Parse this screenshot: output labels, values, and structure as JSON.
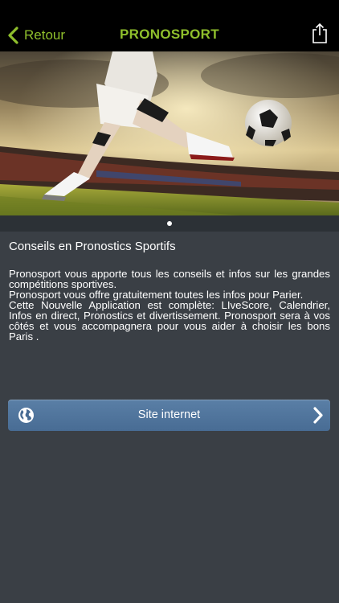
{
  "navbar": {
    "back_label": "Retour",
    "title": "PRONOSPORT",
    "accent_color": "#8fbf2c"
  },
  "hero": {
    "carousel": {
      "page_count": 1,
      "current_page": 1
    }
  },
  "content": {
    "section_title": "Conseils en Pronostics Sportifs",
    "paragraphs": [
      "Pronosport vous apporte tous les conseils et infos sur les grandes compétitions sportives.",
      "Pronosport vous offre gratuitement toutes les infos pour Parier.",
      "Cette Nouvelle Application est complète: LIveScore, Calendrier, Infos en direct, Pronostics et divertissement. Pronosport sera à vos côtés et vous accompagnera pour vous aider à choisir les bons Paris ."
    ]
  },
  "website_button": {
    "label": "Site internet",
    "icon": "globe-icon",
    "color": "#4f7399"
  }
}
